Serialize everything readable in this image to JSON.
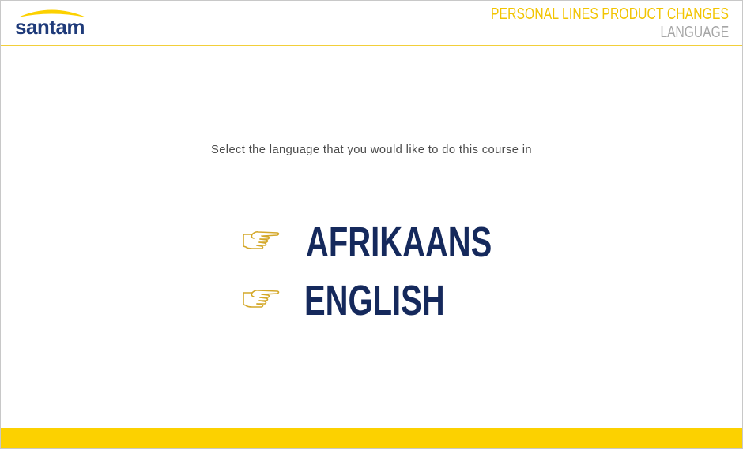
{
  "brand": {
    "logo_text": "santam",
    "logo_icon": "umbrella-arc-logo",
    "brand_blue": "#1f3b7a",
    "brand_yellow": "#fcd100"
  },
  "header": {
    "course_title": "PERSONAL LINES PRODUCT CHANGES",
    "section_title": "LANGUAGE"
  },
  "main": {
    "instruction": "Select the language that you would like to do this course in",
    "options": [
      {
        "label": "AFRIKAANS",
        "icon": "pointing-hand-icon"
      },
      {
        "label": "ENGLISH",
        "icon": "pointing-hand-icon"
      }
    ]
  },
  "colors": {
    "title_yellow": "#f2c400",
    "subtitle_gray": "#a6a6a6",
    "option_navy": "#15295c",
    "hand_gold": "#d4a82a"
  }
}
